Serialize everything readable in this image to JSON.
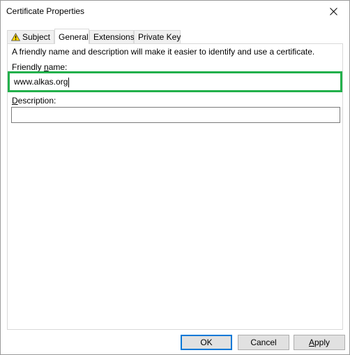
{
  "window": {
    "title": "Certificate Properties"
  },
  "tabs": [
    {
      "label": "Subject"
    },
    {
      "label": "General"
    },
    {
      "label": "Extensions"
    },
    {
      "label": "Private Key"
    }
  ],
  "general": {
    "intro": "A friendly name and description will make it easier to identify and use a certificate.",
    "friendly_name_label_pre": "Friendly ",
    "friendly_name_label_key": "n",
    "friendly_name_label_post": "ame:",
    "friendly_name_value": "www.alkas.org",
    "description_label_key": "D",
    "description_label_post": "escription:",
    "description_value": ""
  },
  "buttons": {
    "ok": "OK",
    "cancel": "Cancel",
    "apply_key": "A",
    "apply_post": "pply"
  },
  "colors": {
    "highlight": "#22b04b",
    "default_button_border": "#0078d7"
  },
  "icons": {
    "subject_tab": "warning-icon",
    "close": "close-icon"
  }
}
